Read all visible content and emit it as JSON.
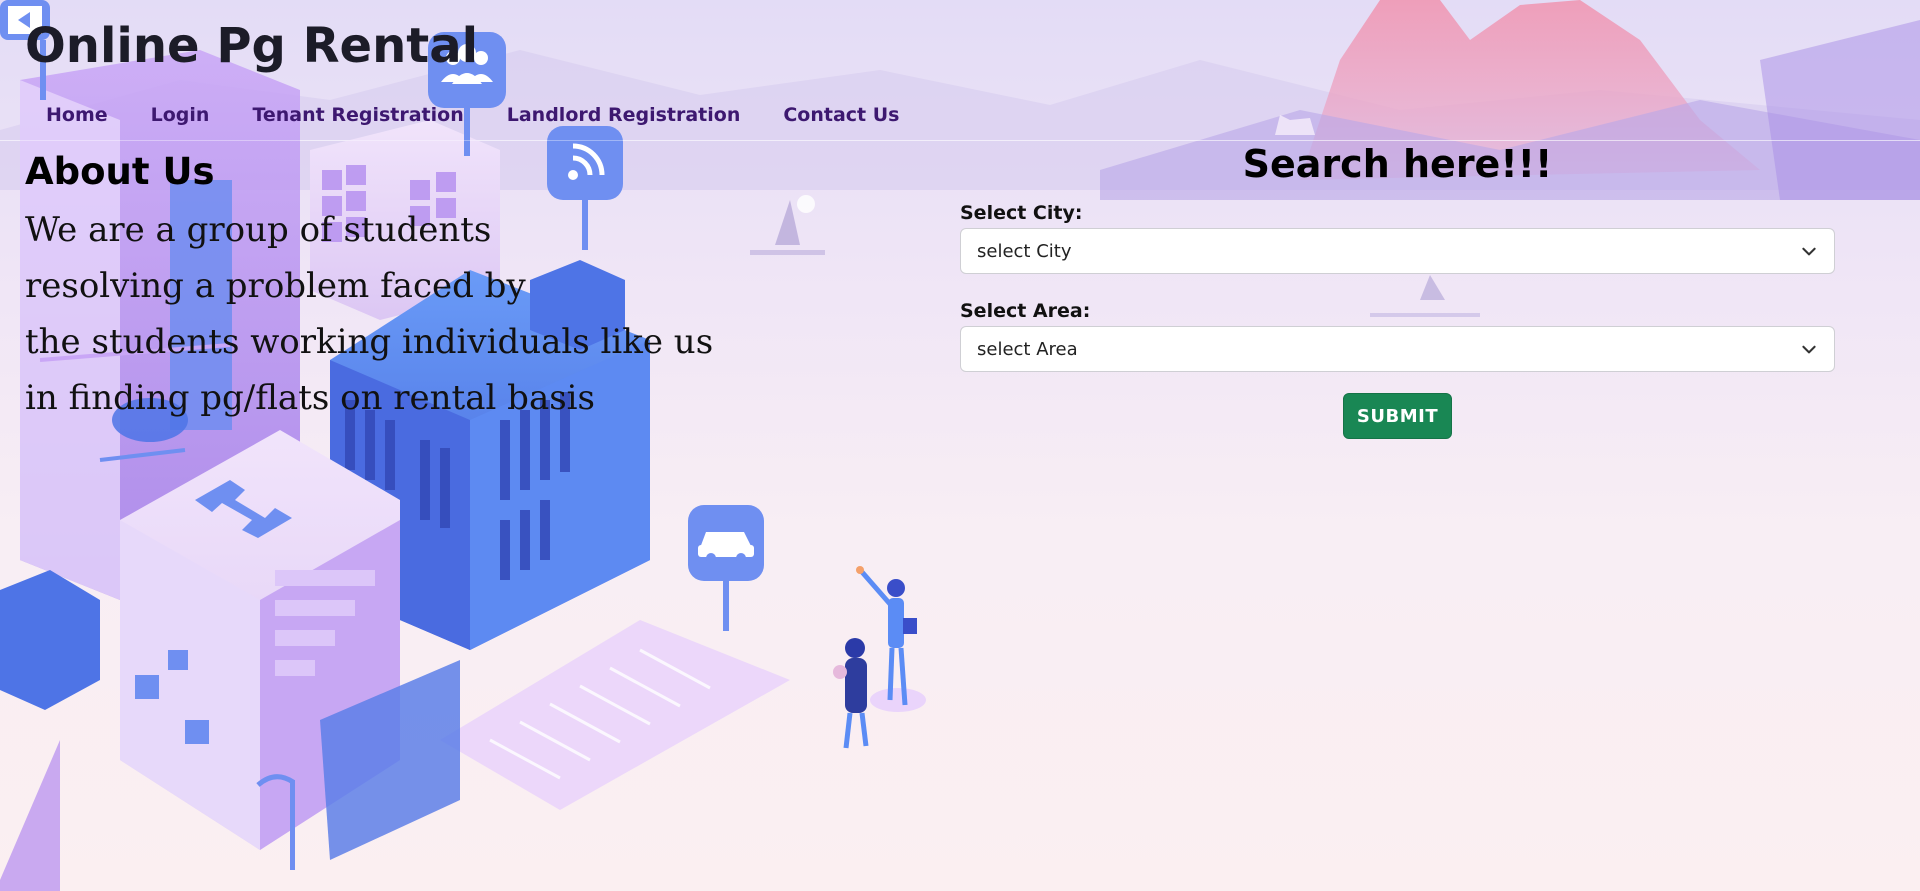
{
  "site": {
    "title": "Online Pg Rental"
  },
  "nav": {
    "home": "Home",
    "login": "Login",
    "tenant_registration": "Tenant Registration",
    "landlord_registration": "Landlord Registration",
    "contact_us": "Contact Us"
  },
  "about": {
    "title": "About Us",
    "lines": [
      "We are a group of students",
      "resolving a problem faced by",
      "the students working individuals like us",
      "in finding pg/flats on rental basis"
    ]
  },
  "search": {
    "title": "Search here!!!",
    "city_label": "Select City:",
    "city_value": "select City",
    "area_label": "Select Area:",
    "area_value": "select Area",
    "submit_label": "SUBMIT"
  },
  "colors": {
    "nav_text": "#3d1870",
    "submit_bg": "#198754",
    "accent_blue": "#5b8cf5",
    "accent_purple": "#b48cf0"
  },
  "icons": [
    "film-icon",
    "users-icon",
    "wifi-icon",
    "car-icon",
    "chevron-down-icon"
  ]
}
